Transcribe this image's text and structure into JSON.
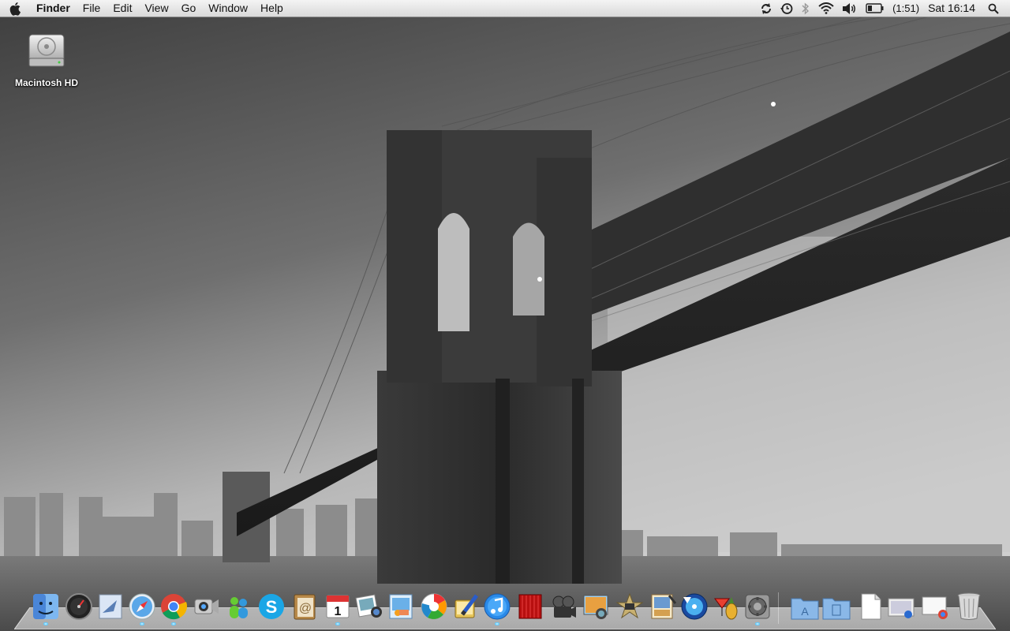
{
  "menubar": {
    "app_name": "Finder",
    "menus": [
      "File",
      "Edit",
      "View",
      "Go",
      "Window",
      "Help"
    ],
    "status_icons": [
      "sync-icon",
      "time-machine-icon",
      "bluetooth-icon",
      "wifi-icon",
      "volume-icon",
      "battery-icon",
      "spotlight-icon"
    ],
    "battery_time": "(1:51)",
    "clock": "Sat 16:14"
  },
  "desktop": {
    "icons": [
      {
        "label": "Macintosh HD",
        "icon": "hard-drive-icon"
      }
    ]
  },
  "dock": {
    "apps": [
      "finder-icon",
      "dashboard-icon",
      "mail-icon",
      "safari-icon",
      "chrome-icon",
      "facetime-icon",
      "messenger-icon",
      "skype-icon",
      "address-book-icon",
      "ical-icon",
      "iphoto-icon",
      "preview-icon",
      "picasa-icon",
      "pixelmator-icon",
      "itunes-icon",
      "front-row-icon",
      "imovie-icon",
      "photo-booth-icon",
      "imovie-star-icon",
      "image-capture-icon",
      "dvd-player-icon",
      "cocktail-icon",
      "system-preferences-icon"
    ],
    "stacks": [
      "applications-folder-icon",
      "documents-folder-icon",
      "document-icon",
      "downloads-stack-icon",
      "chrome-downloads-icon",
      "trash-icon"
    ],
    "running_indicators": [
      0,
      3,
      4,
      9,
      14,
      22
    ]
  },
  "colors": {
    "menubar_top": "#f4f4f4",
    "menubar_bottom": "#d9d9d9",
    "dock_running": "#59c8ff"
  }
}
